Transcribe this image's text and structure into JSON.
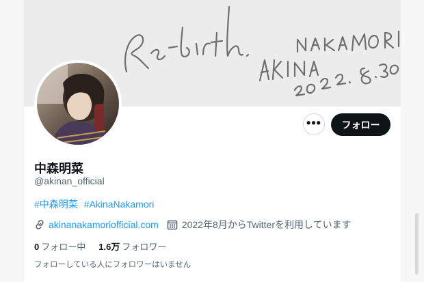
{
  "banner": {
    "signature_lines": [
      "Re-birth.",
      "AKINA NAKAMORI",
      "2022. 8. 30"
    ]
  },
  "profile": {
    "display_name": "中森明菜",
    "handle": "@akinan_official",
    "hashtags": [
      "#中森明菜",
      "#AkinaNakamori"
    ],
    "website": "akinanakamoriofficial.com",
    "joined": "2022年8月からTwitterを利用しています",
    "following_count": "0",
    "following_label": "フォロー中",
    "followers_count": "1.6万",
    "followers_label": "フォロワー",
    "mutual_note": "フォローしている人にフォロワーはいません"
  },
  "actions": {
    "more_label": "•••",
    "follow_label": "フォロー"
  },
  "icons": {
    "more": "more-horizontal-icon",
    "link": "link-icon",
    "calendar": "calendar-icon"
  },
  "colors": {
    "accent": "#1d9bf0",
    "follow_button_bg": "#0f1419",
    "secondary_text": "#536471"
  }
}
